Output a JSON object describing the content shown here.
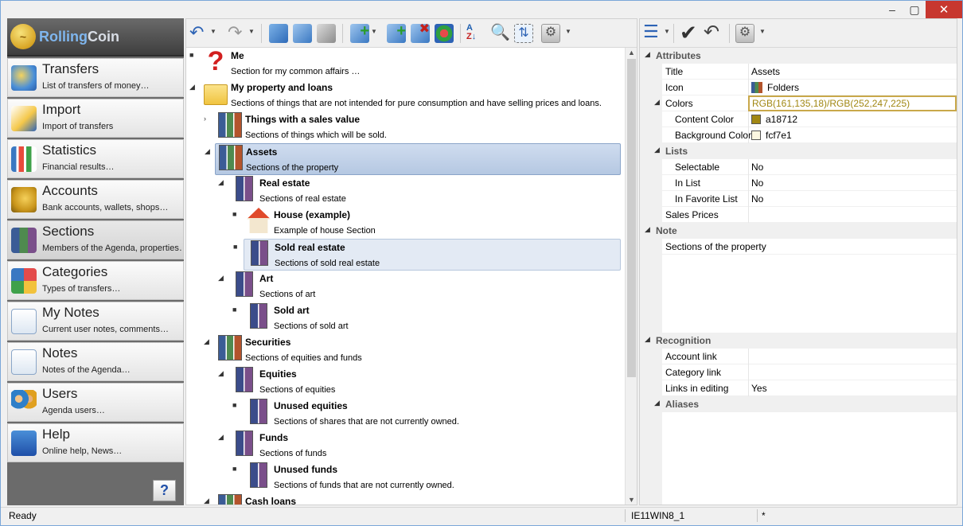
{
  "window": {
    "min": "–",
    "max": "▢",
    "close": "✕"
  },
  "logo": {
    "brand_a": "Rolling",
    "brand_b": "Coin"
  },
  "nav": [
    {
      "title": "Transfers",
      "sub": "List of transfers of money…",
      "icon": "transfers-icon"
    },
    {
      "title": "Import",
      "sub": "Import of transfers",
      "icon": "import-icon"
    },
    {
      "title": "Statistics",
      "sub": "Financial results…",
      "icon": "statistics-icon"
    },
    {
      "title": "Accounts",
      "sub": "Bank accounts, wallets, shops…",
      "icon": "accounts-icon"
    },
    {
      "title": "Sections",
      "sub": "Members of the Agenda, properties…",
      "icon": "sections-icon"
    },
    {
      "title": "Categories",
      "sub": "Types of transfers…",
      "icon": "categories-icon"
    },
    {
      "title": "My Notes",
      "sub": "Current user notes, comments…",
      "icon": "my-notes-icon"
    },
    {
      "title": "Notes",
      "sub": "Notes of the Agenda…",
      "icon": "notes-icon"
    },
    {
      "title": "Users",
      "sub": "Agenda users…",
      "icon": "users-icon"
    },
    {
      "title": "Help",
      "sub": "Online help, News…",
      "icon": "help-icon"
    }
  ],
  "help_corner": "?",
  "tree": [
    {
      "title": "Me",
      "sub": "Section for my common affairs …",
      "exp": "■",
      "icon": "question-icon"
    },
    {
      "title": "My property and loans",
      "sub": "Sections of things that are not intended for pure consumption and have selling prices and loans.",
      "exp": "◢",
      "icon": "folder-icon"
    },
    {
      "title": "Things with a sales value",
      "sub": "Sections of things which will be sold.",
      "exp": "›",
      "icon": "binders-icon"
    },
    {
      "title": "Assets",
      "sub": "Sections of the property",
      "exp": "◢",
      "icon": "binders-icon"
    },
    {
      "title": "Real estate",
      "sub": "Sections of real estate",
      "exp": "◢",
      "icon": "binders-icon"
    },
    {
      "title": "House (example)",
      "sub": "Example of house Section",
      "exp": "■",
      "icon": "house-icon"
    },
    {
      "title": "Sold real estate",
      "sub": "Sections of sold real estate",
      "exp": "■",
      "icon": "binders-icon"
    },
    {
      "title": "Art",
      "sub": "Sections of art",
      "exp": "◢",
      "icon": "binders-icon"
    },
    {
      "title": "Sold art",
      "sub": "Sections of sold art",
      "exp": "■",
      "icon": "binders-icon"
    },
    {
      "title": "Securities",
      "sub": "Sections of equities and funds",
      "exp": "◢",
      "icon": "binders-icon"
    },
    {
      "title": "Equities",
      "sub": "Sections of equities",
      "exp": "◢",
      "icon": "binders-icon"
    },
    {
      "title": "Unused equities",
      "sub": "Sections of shares that are not currently owned.",
      "exp": "■",
      "icon": "binders-icon"
    },
    {
      "title": "Funds",
      "sub": "Sections of funds",
      "exp": "◢",
      "icon": "binders-icon"
    },
    {
      "title": "Unused funds",
      "sub": "Sections of funds that are not currently owned.",
      "exp": "■",
      "icon": "binders-icon"
    },
    {
      "title": "Cash loans",
      "sub": "",
      "exp": "◢",
      "icon": "binders-icon"
    }
  ],
  "props": [
    {
      "name": "Attributes",
      "value": "",
      "cat": true
    },
    {
      "name": "Title",
      "value": "Assets"
    },
    {
      "name": "Icon",
      "value": "Folders"
    },
    {
      "name": "Colors",
      "value": "RGB(161,135,18)/RGB(252,247,225)"
    },
    {
      "name": "Content Color",
      "value": "a18712"
    },
    {
      "name": "Background Color",
      "value": "fcf7e1"
    },
    {
      "name": "Lists",
      "value": "",
      "cat": true
    },
    {
      "name": "Selectable",
      "value": "No"
    },
    {
      "name": "In List",
      "value": "No"
    },
    {
      "name": "In Favorite List",
      "value": "No"
    },
    {
      "name": "Sales Prices",
      "value": ""
    },
    {
      "name": "Note",
      "value": "",
      "cat": true
    },
    {
      "name": "Sections of the property",
      "value": ""
    },
    {
      "name": "Recognition",
      "value": "",
      "cat": true
    },
    {
      "name": "Account link",
      "value": ""
    },
    {
      "name": "Category link",
      "value": ""
    },
    {
      "name": "Links in editing",
      "value": "Yes"
    },
    {
      "name": "Aliases",
      "value": "",
      "cat": true
    }
  ],
  "colors": {
    "content": "#a18712",
    "background": "#fcf7e1",
    "colors_text": "#a18712",
    "selection": "#b5c8e2"
  },
  "status": {
    "left": "Ready",
    "machine": "IE11WIN8_1",
    "flag": "*"
  }
}
